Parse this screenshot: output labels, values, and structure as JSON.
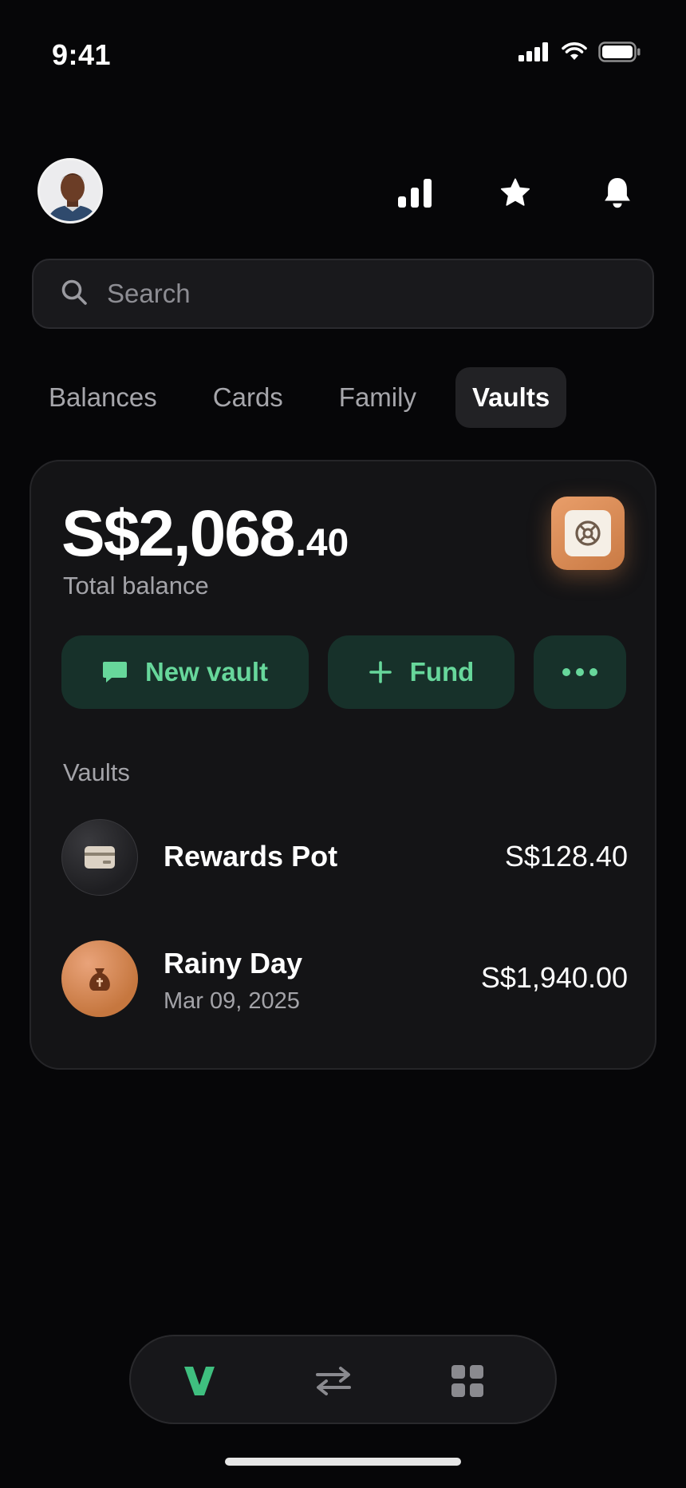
{
  "status_bar": {
    "time": "9:41",
    "icons": [
      "signal-icon",
      "wifi-icon",
      "battery-icon"
    ]
  },
  "header": {
    "avatar_icon": "user-avatar",
    "buttons": [
      {
        "name": "stats-icon"
      },
      {
        "name": "star-icon"
      },
      {
        "name": "bell-icon"
      }
    ]
  },
  "search": {
    "placeholder": "Search",
    "value": "",
    "icon": "search-icon"
  },
  "tabs": [
    {
      "label": "Balances",
      "active": false
    },
    {
      "label": "Cards",
      "active": false
    },
    {
      "label": "Family",
      "active": false
    },
    {
      "label": "Vaults",
      "active": true
    }
  ],
  "summary": {
    "balance_main": "S$2,068",
    "balance_cents": ".40",
    "balance_label": "Total balance",
    "badge_icon": "vault-safe-icon"
  },
  "actions": {
    "new_vault": "New vault",
    "fund": "Fund",
    "more_icon": "more-dots-icon"
  },
  "vaults": {
    "section_label": "Vaults",
    "items": [
      {
        "name": "Rewards Pot",
        "date": "",
        "amount": "S$128.40",
        "icon": "card-icon"
      },
      {
        "name": "Rainy Day",
        "date": "Mar 09, 2025",
        "amount": "S$1,940.00",
        "icon": "money-bag-icon"
      }
    ]
  },
  "bottom_nav": {
    "items": [
      {
        "name": "home-logo-icon",
        "active": true
      },
      {
        "name": "transfer-icon",
        "active": false
      },
      {
        "name": "apps-grid-icon",
        "active": false
      }
    ]
  },
  "colors": {
    "background": "#060608",
    "card": "#141416",
    "accent_green": "#67d79b",
    "action_bg": "#17312a",
    "copper": "#d98a55"
  }
}
